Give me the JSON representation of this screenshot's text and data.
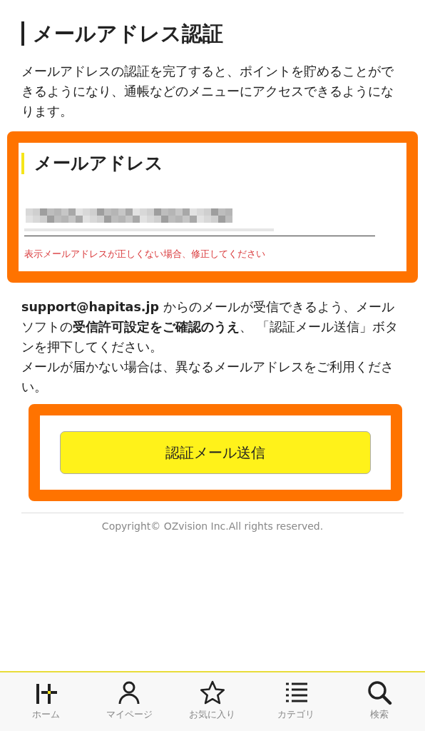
{
  "page_title": "メールアドレス認証",
  "intro": "メールアドレスの認証を完了すると、ポイントを貯めることができるようになり、通帳などのメニューにアクセスできるようになります。",
  "email_section": {
    "heading": "メールアドレス",
    "field": {
      "redacted": true
    },
    "error": "表示メールアドレスが正しくない場合、修正してください"
  },
  "notes": [
    "**support@hapitas.jp** からのメールが受信できるよう、メールソフトの**受信許可設定をご確認のうえ**、 「認証メール送信」ボタンを押下してください。",
    "メールが届かない場合は、異なるメールアドレスをご利用ください。"
  ],
  "submit_button": "認証メール送信",
  "copyright": "Copyright© OZvision Inc.All rights reserved.",
  "tab_bar": [
    {
      "kind": "home",
      "label": "ホーム"
    },
    {
      "kind": "mypage",
      "label": "マイページ"
    },
    {
      "kind": "favorites",
      "label": "お気に入り"
    },
    {
      "kind": "category",
      "label": "カテゴリ"
    },
    {
      "kind": "search",
      "label": "検索"
    }
  ]
}
